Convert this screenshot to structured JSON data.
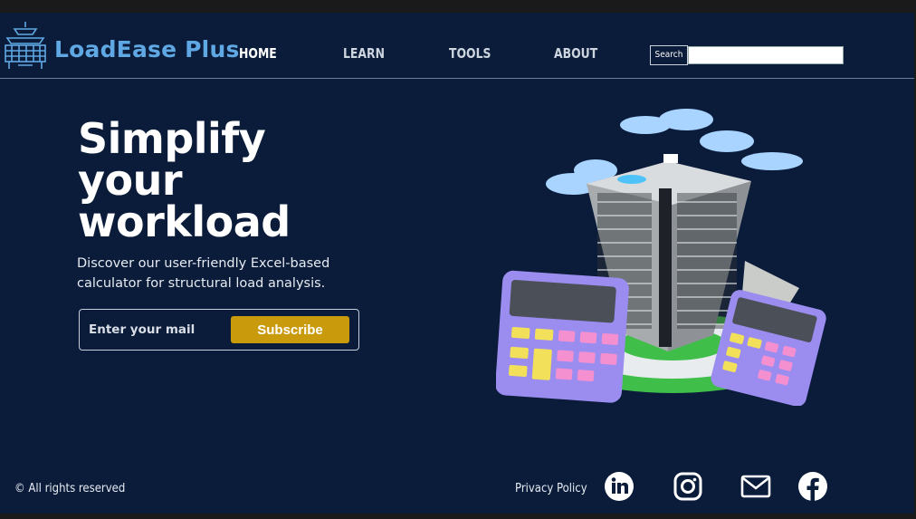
{
  "header": {
    "brand": "LoadEase Plus",
    "nav": [
      {
        "label": "HOME",
        "active": true
      },
      {
        "label": "LEARN",
        "active": false
      },
      {
        "label": "TOOLS",
        "active": false
      },
      {
        "label": "ABOUT",
        "active": false
      }
    ],
    "search": {
      "label": "Search",
      "value": ""
    }
  },
  "hero": {
    "title_lines": [
      "Simplify",
      "your",
      "workload"
    ],
    "subtitle": "Discover our user-friendly Excel-based calculator for structural load analysis.",
    "email_placeholder": "Enter your mail",
    "subscribe_label": "Subscribe"
  },
  "footer": {
    "copyright": "© All rights reserved",
    "privacy": "Privacy Policy",
    "social": [
      "linkedin-icon",
      "instagram-icon",
      "mail-icon",
      "facebook-icon"
    ]
  },
  "colors": {
    "background": "#0b1c3a",
    "brand": "#5fa8e3",
    "button": "#c89a0c"
  }
}
